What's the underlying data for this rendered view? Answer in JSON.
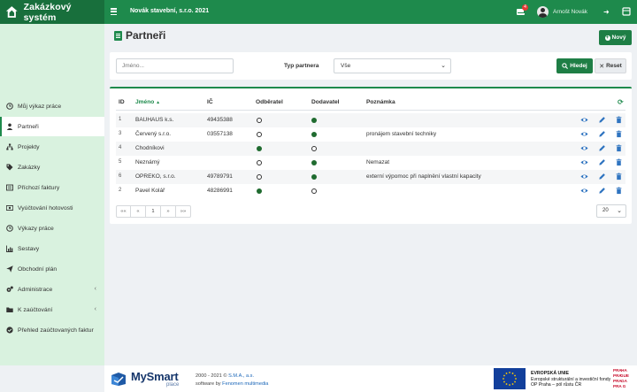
{
  "app": {
    "title": "Zakázkový systém",
    "company": "Novák stavební, s.r.o. 2021"
  },
  "header": {
    "notification_count": "4",
    "user_name": "Arnošt Novák"
  },
  "sidebar": {
    "items": [
      {
        "label": "Můj výkaz práce",
        "icon": "clock-icon",
        "active": false
      },
      {
        "label": "Partneři",
        "icon": "person-icon",
        "active": true
      },
      {
        "label": "Projekty",
        "icon": "sitemap-icon",
        "active": false
      },
      {
        "label": "Zakázky",
        "icon": "tags-icon",
        "active": false
      },
      {
        "label": "Příchozí faktury",
        "icon": "file-icon",
        "active": false
      },
      {
        "label": "Vyúčtování hotovosti",
        "icon": "money-icon",
        "active": false
      },
      {
        "label": "Výkazy práce",
        "icon": "clock-icon",
        "active": false
      },
      {
        "label": "Sestavy",
        "icon": "bar-chart-icon",
        "active": false
      },
      {
        "label": "Obchodní plán",
        "icon": "send-icon",
        "active": false
      },
      {
        "label": "Administrace",
        "icon": "gears-icon",
        "active": false,
        "expandable": true
      },
      {
        "label": "K zaúčtování",
        "icon": "folder-icon",
        "active": false,
        "expandable": true
      },
      {
        "label": "Přehled zaúčtovaných faktur",
        "icon": "check-circle-icon",
        "active": false
      }
    ]
  },
  "page": {
    "title": "Partneři",
    "new_button": "Nový"
  },
  "filter": {
    "name_placeholder": "Jméno...",
    "partner_type_label": "Typ partnera",
    "partner_type_value": "Vše",
    "search_button": "Hledej",
    "reset_button": "Reset"
  },
  "table": {
    "columns": {
      "id": "ID",
      "name": "Jméno",
      "ic": "IČ",
      "customer": "Odběratel",
      "supplier": "Dodavatel",
      "note": "Poznámka"
    },
    "rows": [
      {
        "id": "1",
        "name": "BAUHAUS k.s.",
        "ic": "49435388",
        "customer": false,
        "supplier": true,
        "note": ""
      },
      {
        "id": "3",
        "name": "Červený s.r.o.",
        "ic": "03557138",
        "customer": false,
        "supplier": true,
        "note": "pronájem stavební techniky"
      },
      {
        "id": "4",
        "name": "Chodníkovi",
        "ic": "",
        "customer": true,
        "supplier": false,
        "note": ""
      },
      {
        "id": "5",
        "name": "Neznámý",
        "ic": "",
        "customer": false,
        "supplier": true,
        "note": "Nemazat"
      },
      {
        "id": "6",
        "name": "OPREKO, s.r.o.",
        "ic": "49789791",
        "customer": false,
        "supplier": true,
        "note": "externí výpomoc při naplnění vlastní kapacity"
      },
      {
        "id": "2",
        "name": "Pavel Kolář",
        "ic": "48286991",
        "customer": true,
        "supplier": false,
        "note": ""
      }
    ]
  },
  "pagination": {
    "first": "««",
    "prev": "«",
    "current": "1",
    "next": "»",
    "last": "»»",
    "page_size": "20"
  },
  "footer": {
    "brand_my": "MySmart",
    "brand_place": "place",
    "copyright_prefix": "2000 - 2021 ©",
    "copyright_company": "S.M.A., a.s.",
    "software_prefix": "software by",
    "software_company": "Fenomen multimedia",
    "eu_line1": "EVROPSKÁ UNIE",
    "eu_line2": "Evropské strukturální a investiční fondy",
    "eu_line3": "OP Praha – pól růstu ČR",
    "praha_logo": "PRA HA PRA GUE PRA GA PRA G"
  },
  "colors": {
    "primary": "#1e8a4c",
    "primary_dark": "#186f3c",
    "sidebar_bg": "#d9f2df",
    "dot_green": "#1f6b2f",
    "badge_red": "#e53935"
  }
}
